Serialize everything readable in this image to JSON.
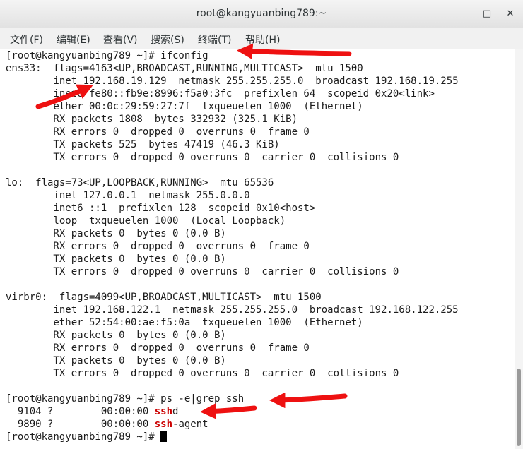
{
  "window": {
    "title": "root@kangyuanbing789:~"
  },
  "window_controls": {
    "minimize": "_",
    "maximize": "□",
    "close": "✕"
  },
  "menu": [
    "文件(F)",
    "编辑(E)",
    "查看(V)",
    "搜索(S)",
    "终端(T)",
    "帮助(H)"
  ],
  "terminal": {
    "lines": [
      "[root@kangyuanbing789 ~]# ifconfig",
      "ens33:  flags=4163<UP,BROADCAST,RUNNING,MULTICAST>  mtu 1500",
      "        inet 192.168.19.129  netmask 255.255.255.0  broadcast 192.168.19.255",
      "        inet6 fe80::fb9e:8996:f5a0:3fc  prefixlen 64  scopeid 0x20<link>",
      "        ether 00:0c:29:59:27:7f  txqueuelen 1000  (Ethernet)",
      "        RX packets 1808  bytes 332932 (325.1 KiB)",
      "        RX errors 0  dropped 0  overruns 0  frame 0",
      "        TX packets 525  bytes 47419 (46.3 KiB)",
      "        TX errors 0  dropped 0 overruns 0  carrier 0  collisions 0",
      "",
      "lo:  flags=73<UP,LOOPBACK,RUNNING>  mtu 65536",
      "        inet 127.0.0.1  netmask 255.0.0.0",
      "        inet6 ::1  prefixlen 128  scopeid 0x10<host>",
      "        loop  txqueuelen 1000  (Local Loopback)",
      "        RX packets 0  bytes 0 (0.0 B)",
      "        RX errors 0  dropped 0  overruns 0  frame 0",
      "        TX packets 0  bytes 0 (0.0 B)",
      "        TX errors 0  dropped 0 overruns 0  carrier 0  collisions 0",
      "",
      "virbr0:  flags=4099<UP,BROADCAST,MULTICAST>  mtu 1500",
      "        inet 192.168.122.1  netmask 255.255.255.0  broadcast 192.168.122.255",
      "        ether 52:54:00:ae:f5:0a  txqueuelen 1000  (Ethernet)",
      "        RX packets 0  bytes 0 (0.0 B)",
      "        RX errors 0  dropped 0  overruns 0  frame 0",
      "        TX packets 0  bytes 0 (0.0 B)",
      "        TX errors 0  dropped 0 overruns 0  carrier 0  collisions 0",
      "",
      "[root@kangyuanbing789 ~]# ps -e|grep ssh"
    ],
    "ps_rows": [
      {
        "prefix": "  9104 ?        00:00:00 ",
        "match": "ssh",
        "rest": "d"
      },
      {
        "prefix": "  9890 ?        00:00:00 ",
        "match": "ssh",
        "rest": "-agent"
      }
    ],
    "final_prompt": "[root@kangyuanbing789 ~]# "
  },
  "colors": {
    "annotation_arrow": "#ee1111",
    "grep_match": "#cc0000",
    "terminal_bg": "#ffffff",
    "text": "#1c1c1c"
  }
}
